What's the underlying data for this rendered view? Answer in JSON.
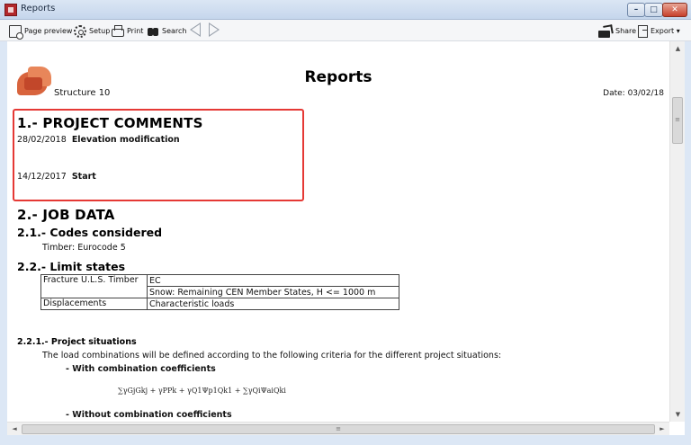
{
  "window": {
    "title": "Reports"
  },
  "window_controls": {
    "minimize": "–",
    "maximize": "□",
    "close": "✕"
  },
  "toolbar": {
    "page_preview": "Page preview",
    "setup": "Setup",
    "print": "Print",
    "search": "Search",
    "share": "Share",
    "export": "Export ▾"
  },
  "report": {
    "title": "Reports",
    "structure": "Structure 10",
    "date": "Date: 03/02/18",
    "sections": {
      "s1": "1.- PROJECT COMMENTS",
      "s2": "2.- JOB DATA",
      "s21": "2.1.- Codes considered",
      "s22": "2.2.- Limit states",
      "s221": "2.2.1.- Project situations"
    },
    "comments": [
      {
        "date": "28/02/2018",
        "text": "Elevation modification"
      },
      {
        "date": "14/12/2017",
        "text": "Start"
      }
    ],
    "codes_considered": "Timber: Eurocode 5",
    "limit_states": [
      {
        "label": "Fracture U.L.S. Timber",
        "value1": "EC",
        "value2": "Snow: Remaining CEN Member States, H <= 1000 m"
      },
      {
        "label": "Displacements",
        "value1": "Characteristic loads"
      }
    ],
    "project_situations_intro": "The load combinations will be defined according to the following criteria for the different project situations:",
    "with_coeffs": "- With combination coefficients",
    "without_coeffs": "- Without combination coefficients",
    "formula": "∑γGjGkj + γPPk + γQ1Ψp1Qk1 + ∑γQiΨaiQki"
  },
  "scrollbars": {
    "up": "▲",
    "down": "▼",
    "left": "◄",
    "right": "►",
    "grip_v": "≡",
    "grip_h": "≡"
  }
}
